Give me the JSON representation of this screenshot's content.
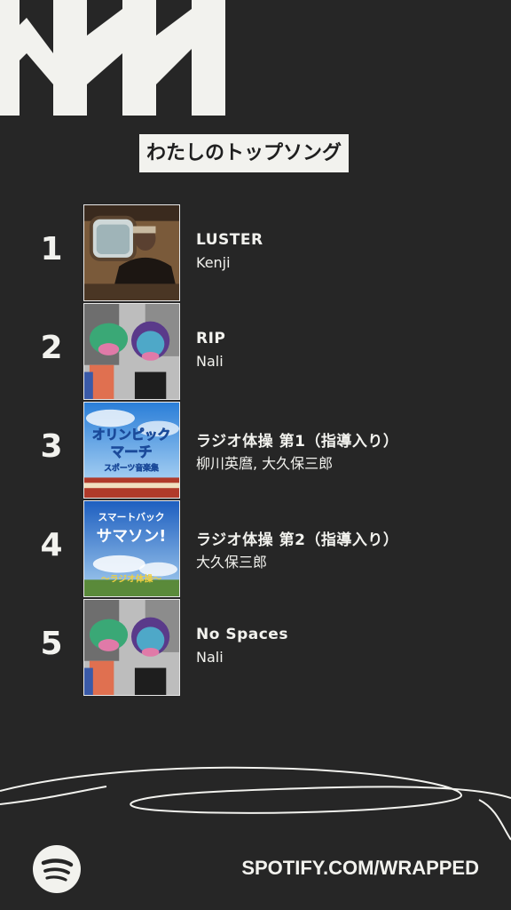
{
  "header": {
    "title": "わたしのトップソング"
  },
  "tracks": [
    {
      "rank": "1",
      "title": "LUSTER",
      "artist": "Kenji"
    },
    {
      "rank": "2",
      "title": "RIP",
      "artist": "Nali"
    },
    {
      "rank": "3",
      "title": "ラジオ体操 第1（指導入り）",
      "artist": "柳川英麿, 大久保三郎",
      "art_text": {
        "line1": "オリンピック",
        "line2": "マーチ",
        "line3": "スポーツ音楽集"
      }
    },
    {
      "rank": "4",
      "title": "ラジオ体操 第2（指導入り）",
      "artist": "大久保三郎",
      "art_text": {
        "line1": "スマートバック",
        "line2": "サマソン!",
        "line3": "〜ラジオ体操〜"
      }
    },
    {
      "rank": "5",
      "title": "No Spaces",
      "artist": "Nali"
    }
  ],
  "footer": {
    "url": "SPOTIFY.COM/WRAPPED",
    "logo_icon": "spotify-logo-icon"
  },
  "colors": {
    "background": "#262626",
    "foreground": "#f2f2ee"
  }
}
